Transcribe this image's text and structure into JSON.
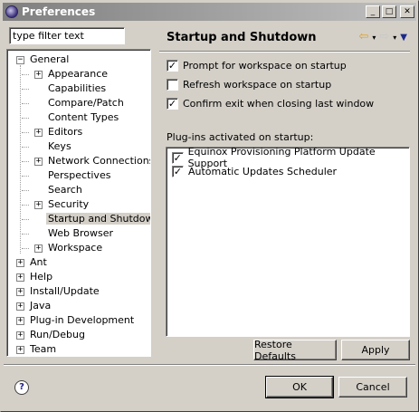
{
  "window": {
    "title": "Preferences",
    "controls": {
      "minimize": "_",
      "maximize": "□",
      "close": "✕"
    }
  },
  "filter": {
    "placeholder": "type filter text",
    "value": "type filter text"
  },
  "tree": {
    "items": [
      {
        "label": "General",
        "expander": "−"
      },
      {
        "label": "Appearance",
        "expander": "+"
      },
      {
        "label": "Capabilities",
        "expander": ""
      },
      {
        "label": "Compare/Patch",
        "expander": ""
      },
      {
        "label": "Content Types",
        "expander": ""
      },
      {
        "label": "Editors",
        "expander": "+"
      },
      {
        "label": "Keys",
        "expander": ""
      },
      {
        "label": "Network Connections",
        "expander": "+"
      },
      {
        "label": "Perspectives",
        "expander": ""
      },
      {
        "label": "Search",
        "expander": ""
      },
      {
        "label": "Security",
        "expander": "+"
      },
      {
        "label": "Startup and Shutdown",
        "expander": "",
        "selected": true
      },
      {
        "label": "Web Browser",
        "expander": ""
      },
      {
        "label": "Workspace",
        "expander": "+"
      },
      {
        "label": "Ant",
        "expander": "+"
      },
      {
        "label": "Help",
        "expander": "+"
      },
      {
        "label": "Install/Update",
        "expander": "+"
      },
      {
        "label": "Java",
        "expander": "+"
      },
      {
        "label": "Plug-in Development",
        "expander": "+"
      },
      {
        "label": "Run/Debug",
        "expander": "+"
      },
      {
        "label": "Team",
        "expander": "+"
      }
    ]
  },
  "page": {
    "title": "Startup and Shutdown",
    "icons": {
      "back": "⇦",
      "forward": "⇨",
      "menu": "▼",
      "caret": "▾"
    },
    "options": [
      {
        "label": "Prompt for workspace on startup",
        "checked": true
      },
      {
        "label": "Refresh workspace on startup",
        "checked": false
      },
      {
        "label": "Confirm exit when closing last window",
        "checked": true
      }
    ],
    "plugins_label": "Plug-ins activated on startup:",
    "plugins": [
      {
        "label": "Equinox Provisioning Platform Update Support",
        "checked": true
      },
      {
        "label": "Automatic Updates Scheduler",
        "checked": true
      }
    ],
    "restore_defaults": "Restore Defaults",
    "apply": "Apply"
  },
  "footer": {
    "help": "?",
    "ok": "OK",
    "cancel": "Cancel"
  },
  "check_mark": "✓"
}
